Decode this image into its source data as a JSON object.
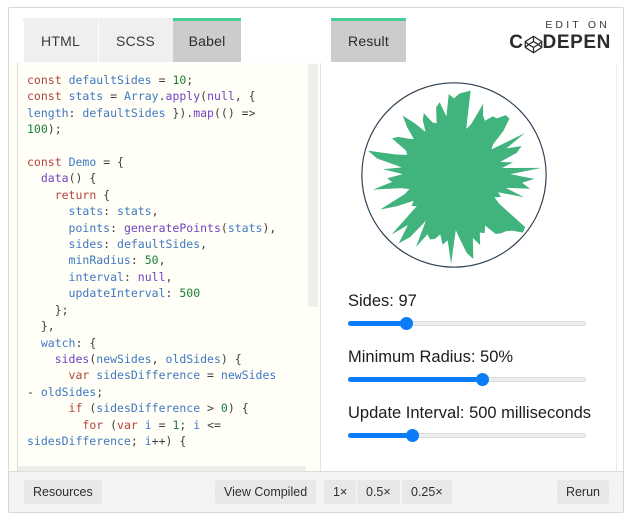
{
  "window": {
    "logo": {
      "edit_on": "EDIT ON",
      "word_left": "C",
      "word_right": "DEPEN",
      "cube_icon": "codepen-cube-icon"
    }
  },
  "tabs": [
    {
      "id": "html",
      "label": "HTML",
      "active": false
    },
    {
      "id": "scss",
      "label": "SCSS",
      "active": false
    },
    {
      "id": "babel",
      "label": "Babel",
      "active": true
    },
    {
      "id": "result",
      "label": "Result",
      "active": true
    }
  ],
  "editor": {
    "language": "Babel",
    "background": "#fffff8",
    "code_lines": [
      "const defaultSides = 10;",
      "const stats = Array.apply(null, {",
      "length: defaultSides }).map(() =>",
      "100);",
      "",
      "const Demo = {",
      "  data() {",
      "    return {",
      "      stats: stats,",
      "      points: generatePoints(stats),",
      "      sides: defaultSides,",
      "      minRadius: 50,",
      "      interval: null,",
      "      updateInterval: 500",
      "    };",
      "  },",
      "  watch: {",
      "    sides(newSides, oldSides) {",
      "      var sidesDifference = newSides",
      "- oldSides;",
      "      if (sidesDifference > 0) {",
      "        for (var i = 1; i <=",
      "sidesDifference; i++) {"
    ]
  },
  "result": {
    "graphic": {
      "name": "animated-starburst-polygon",
      "fill_color": "#41b37d",
      "circle_stroke": "#2c3e50",
      "sides": 97,
      "min_radius_percent": 50
    },
    "controls": [
      {
        "id": "sides",
        "label": "Sides: 97",
        "value": 97,
        "min": 0,
        "max": 400,
        "percent": 24
      },
      {
        "id": "min-radius",
        "label": "Minimum Radius: 50%",
        "value": 50,
        "min": 0,
        "max": 100,
        "percent": 56
      },
      {
        "id": "update-interval",
        "label": "Update Interval: 500 milliseconds",
        "value": 500,
        "min": 0,
        "max": 2000,
        "percent": 26
      }
    ]
  },
  "footer": {
    "resources": "Resources",
    "view_compiled": "View Compiled",
    "zoom_1x": "1×",
    "zoom_05x": "0.5×",
    "zoom_025x": "0.25×",
    "rerun": "Rerun"
  }
}
